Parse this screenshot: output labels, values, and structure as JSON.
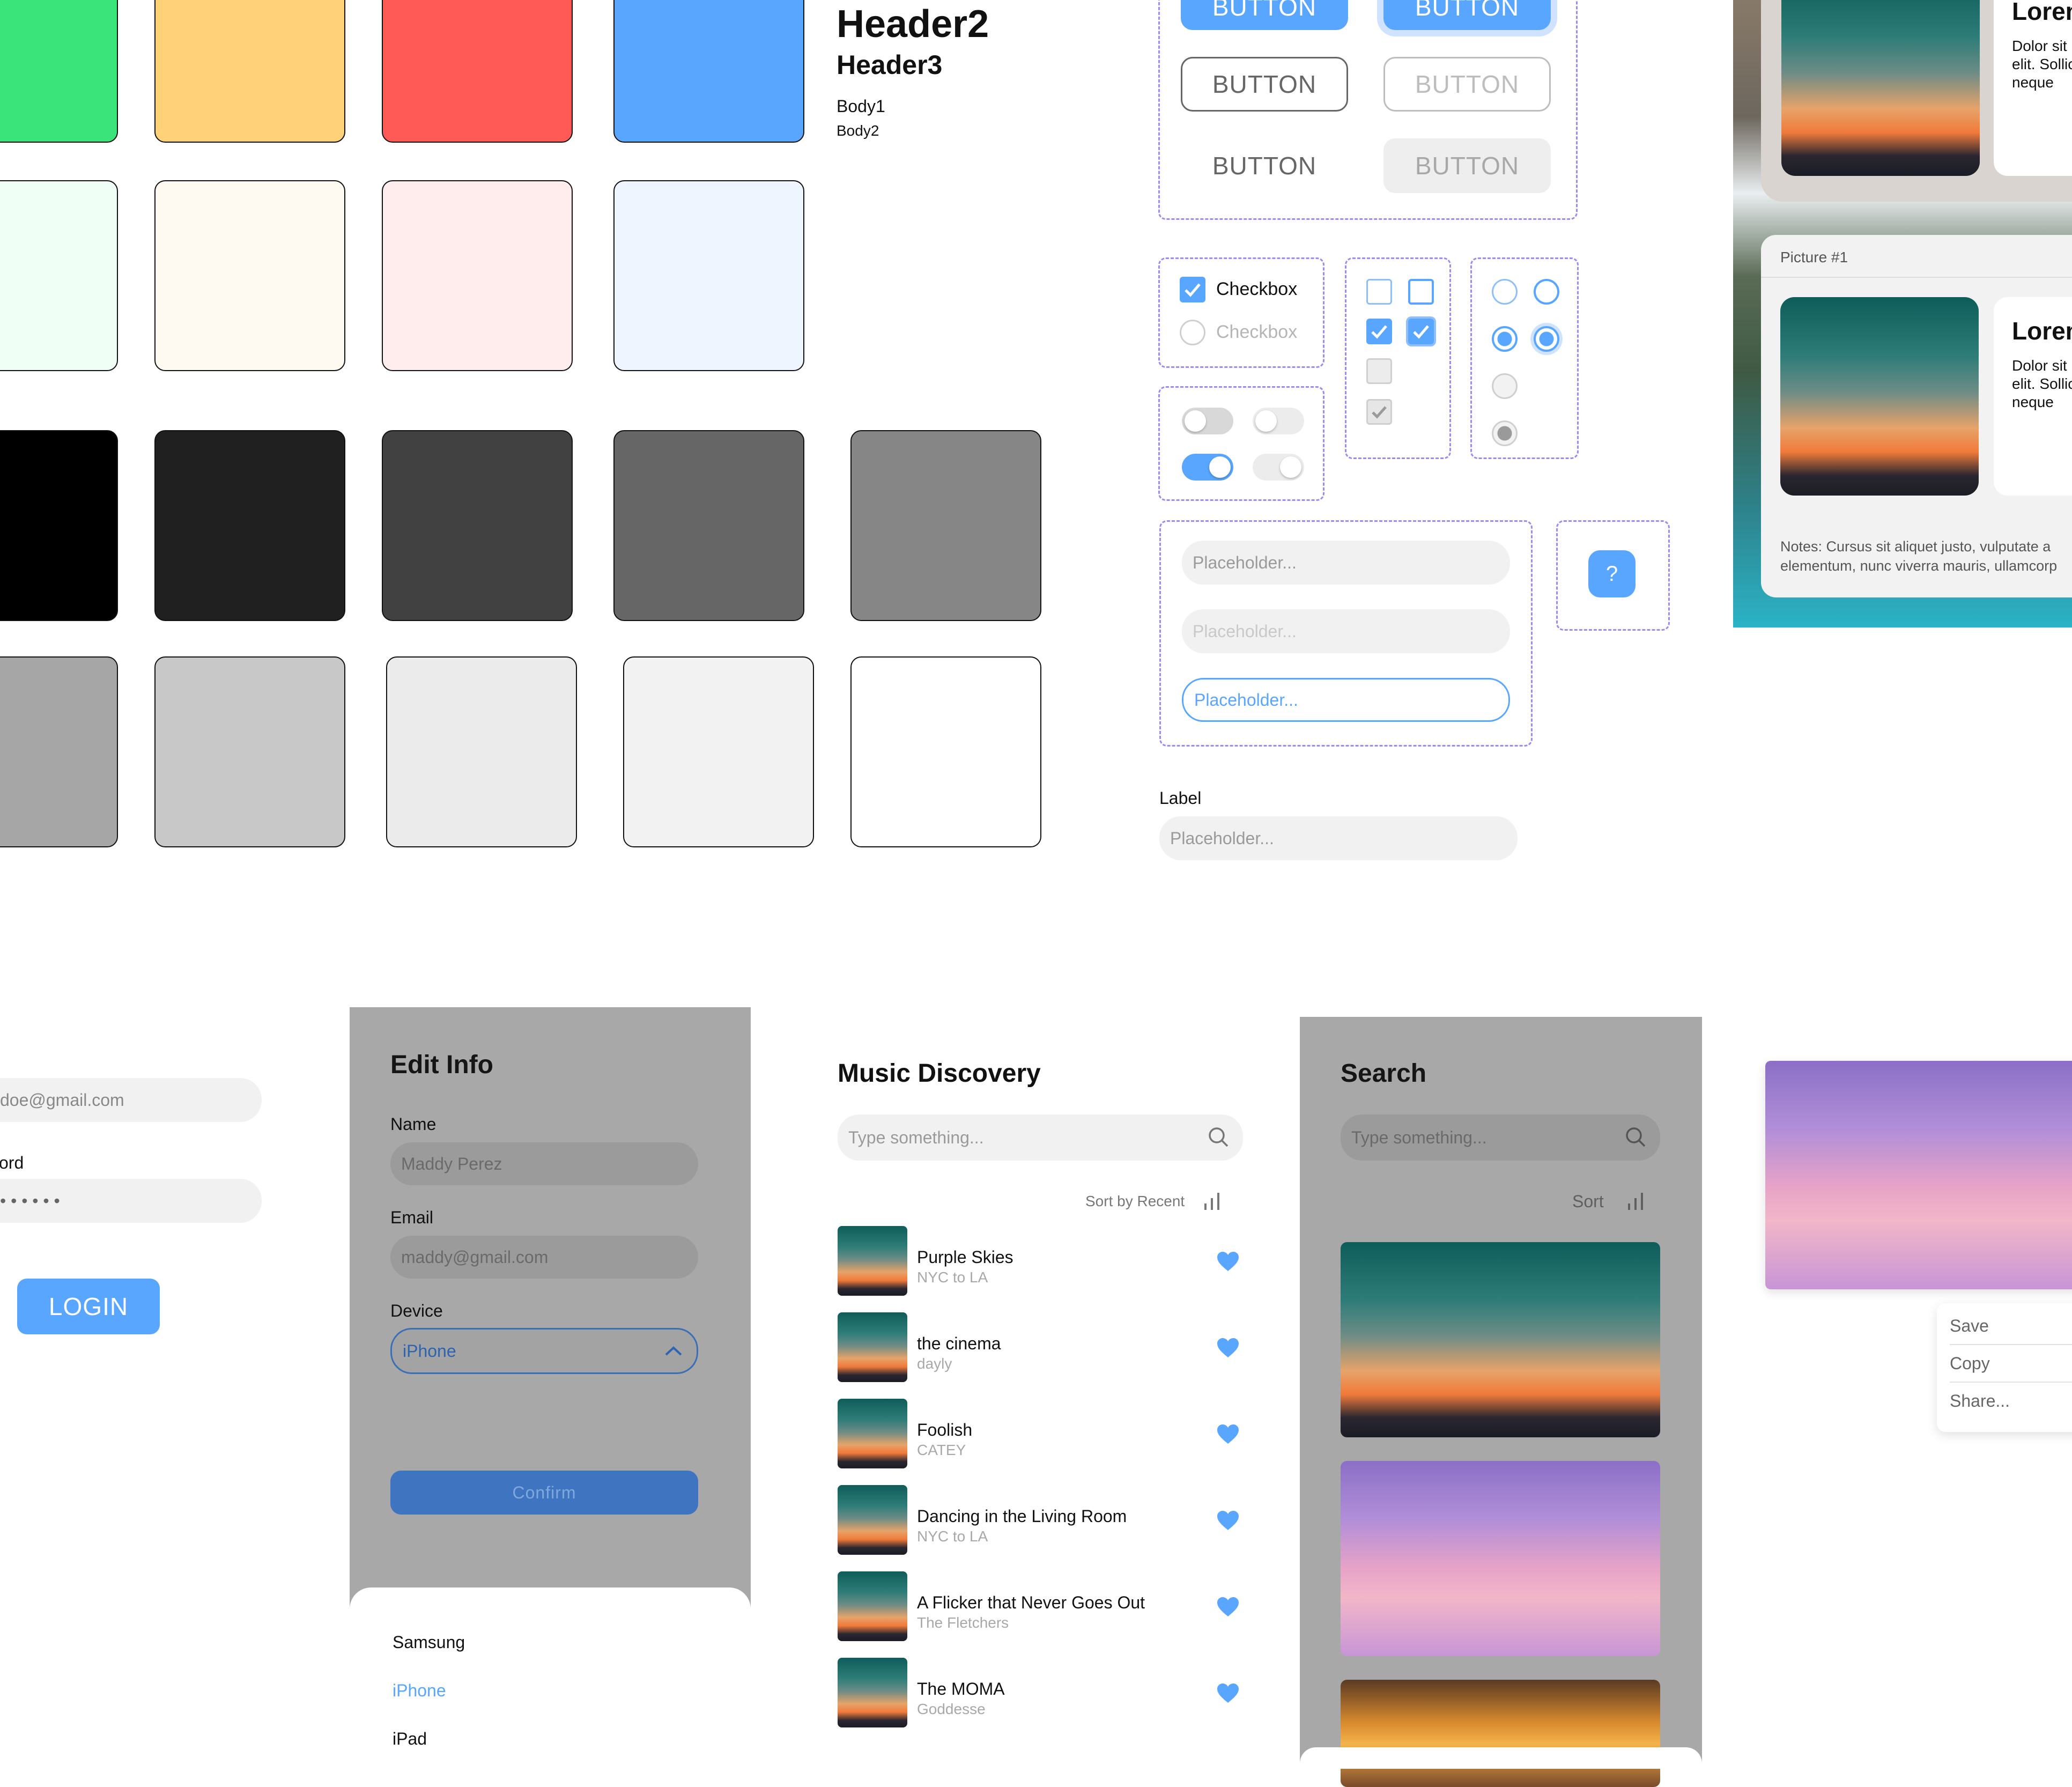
{
  "typography": {
    "h2": "Header2",
    "h3": "Header3",
    "body1": "Body1",
    "body2": "Body2"
  },
  "colors": {
    "green": "#3be47a",
    "yellow": "#ffd27a",
    "red": "#ff5a56",
    "blue": "#58a6ff",
    "light_green": "#effff6",
    "light_yellow": "#fffaf1",
    "light_red": "#ffeced",
    "light_blue": "#eef5ff",
    "grays": [
      "#000000",
      "#202020",
      "#414141",
      "#666666",
      "#868686",
      "#a6a6a6",
      "#c8c8c8",
      "#ebebeb",
      "#f2f2f2",
      "#ffffff"
    ]
  },
  "buttons": {
    "label": "BUTTON"
  },
  "checkboxes": {
    "label": "Checkbox",
    "label_disabled": "Checkbox"
  },
  "inputs": {
    "placeholder": "Placeholder...",
    "label": "Label",
    "help_glyph": "?"
  },
  "cards": [
    {
      "title": "Lorem",
      "body_lines": [
        "Dolor sit",
        "elit. Sollic",
        "neque"
      ]
    },
    {
      "picture_label": "Picture #1",
      "title": "Lorem",
      "body_lines": [
        "Dolor sit",
        "elit. Sollic",
        "neque"
      ],
      "notes_lines": [
        "Notes: Cursus sit aliquet justo, vulputate a",
        "elementum, nunc viverra mauris, ullamcorp"
      ]
    }
  ],
  "login": {
    "email": "doe@gmail.com",
    "password_label": "ord",
    "password_mask": "• • • • • •",
    "button": "LOGIN"
  },
  "edit_info": {
    "title": "Edit Info",
    "name_label": "Name",
    "name_value": "Maddy Perez",
    "email_label": "Email",
    "email_value": "maddy@gmail.com",
    "device_label": "Device",
    "device_value": "iPhone",
    "confirm": "Confirm",
    "options": [
      "Samsung",
      "iPhone",
      "iPad"
    ]
  },
  "music": {
    "title": "Music Discovery",
    "search_placeholder": "Type something...",
    "sort_label": "Sort by Recent",
    "songs": [
      {
        "title": "Purple Skies",
        "artist": "NYC to LA"
      },
      {
        "title": "the cinema",
        "artist": "dayly"
      },
      {
        "title": "Foolish",
        "artist": "CATEY"
      },
      {
        "title": "Dancing in the Living Room",
        "artist": "NYC to LA"
      },
      {
        "title": "A Flicker that Never Goes Out",
        "artist": "The Fletchers"
      },
      {
        "title": "The MOMA",
        "artist": "Goddesse"
      }
    ]
  },
  "search": {
    "title": "Search",
    "placeholder": "Type something...",
    "sort_label": "Sort"
  },
  "context_menu": {
    "items": [
      "Save",
      "Copy",
      "Share..."
    ]
  }
}
